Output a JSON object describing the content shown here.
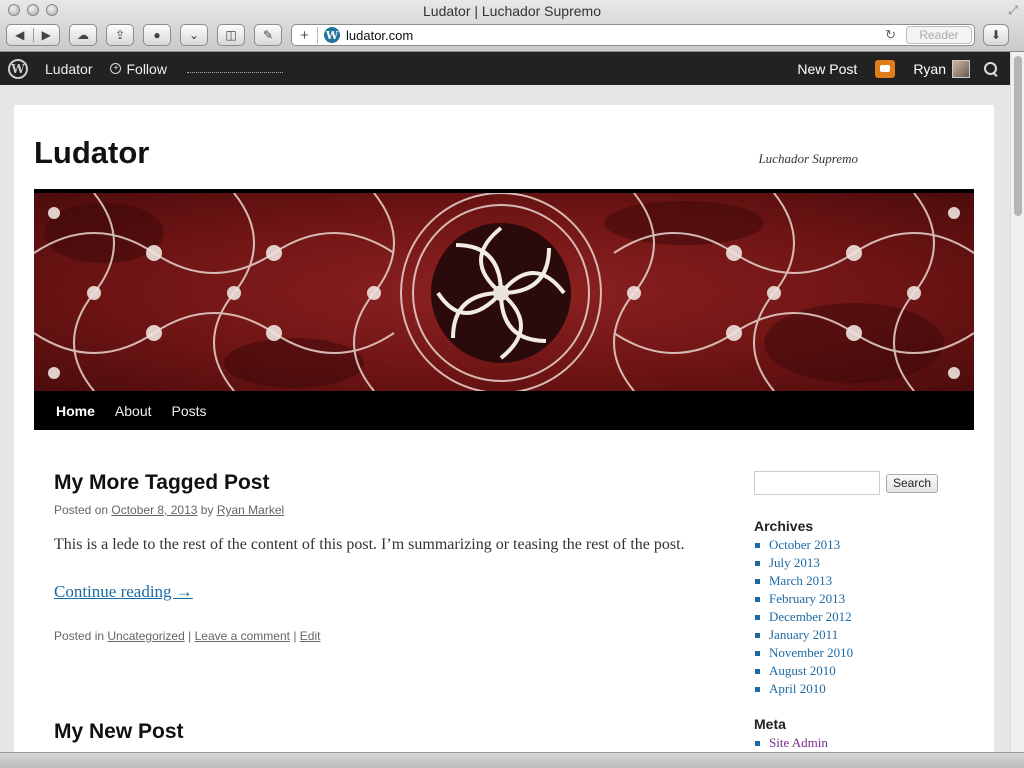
{
  "window": {
    "title": "Ludator | Luchador Supremo",
    "url": "ludator.com",
    "reader_label": "Reader"
  },
  "adminbar": {
    "site_name": "Ludator",
    "follow_label": "Follow",
    "new_post_label": "New Post",
    "user_name": "Ryan",
    "notification_color": "#e07d1a"
  },
  "site": {
    "title": "Ludator",
    "description": "Luchador Supremo",
    "nav": [
      "Home",
      "About",
      "Posts"
    ]
  },
  "post": {
    "title": "My More Tagged Post",
    "meta_prefix": "Posted on",
    "date": "October 8, 2013",
    "by": "by",
    "author": "Ryan Markel",
    "body": "This is a lede to the rest of the content of this post. I’m summarizing or teasing the rest of the post.",
    "continue": "Continue reading →",
    "footer_prefix": "Posted in",
    "category": "Uncategorized",
    "leave_comment": "Leave a comment",
    "edit": "Edit"
  },
  "next_post": {
    "title": "My New Post"
  },
  "sidebar": {
    "search_button": "Search",
    "archives_title": "Archives",
    "archives": [
      "October 2013",
      "July 2013",
      "March 2013",
      "February 2013",
      "December 2012",
      "January 2011",
      "November 2010",
      "August 2010",
      "April 2010"
    ],
    "meta_title": "Meta",
    "meta": [
      "Site Admin"
    ]
  },
  "colors": {
    "link": "#1b6aa5",
    "visited": "#7a2a8c",
    "header_red": "#7c1818",
    "adminbar": "#222222"
  }
}
